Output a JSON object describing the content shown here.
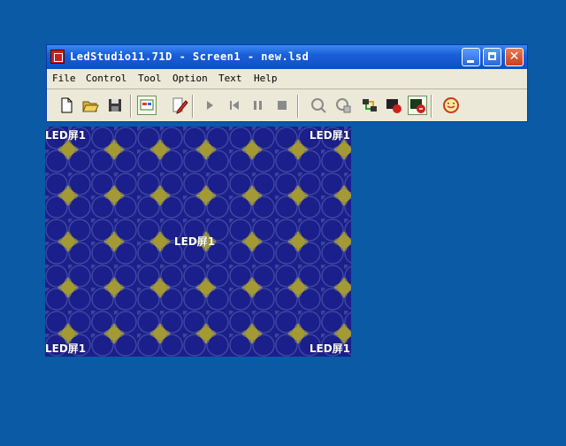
{
  "window": {
    "title": "LedStudio11.71D - Screen1 - new.lsd"
  },
  "menu": [
    {
      "label": "File"
    },
    {
      "label": "Control"
    },
    {
      "label": "Tool"
    },
    {
      "label": "Option"
    },
    {
      "label": "Text"
    },
    {
      "label": "Help"
    }
  ],
  "toolbar": {
    "buttons": [
      "new-file-icon",
      "open-folder-icon",
      "save-icon",
      "screen-setup-icon",
      "edit-pen-icon",
      "play-icon",
      "step-back-icon",
      "pause-icon",
      "stop-icon",
      "find-screen-icon",
      "find-card-icon",
      "connect-icon",
      "display-off-icon",
      "display-on-icon",
      "face-icon"
    ]
  },
  "screen": {
    "label_top_left": "LED屏1",
    "label_top_right": "LED屏1",
    "label_center": "LED屏1",
    "label_bottom_left": "LED屏1",
    "label_bottom_right": "LED屏1"
  }
}
